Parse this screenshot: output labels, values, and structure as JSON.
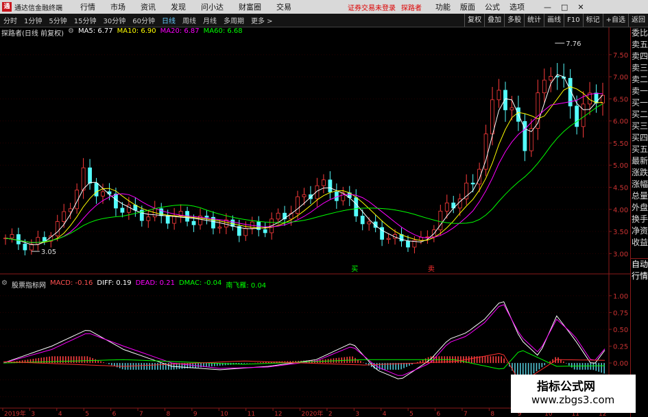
{
  "window": {
    "title": "通达信金融终端",
    "menus": [
      "行情",
      "市场",
      "资讯",
      "发现",
      "问小达",
      "财富圈",
      "交易"
    ],
    "warning": "证券交易未登录",
    "user": "探路者",
    "right_menus": [
      "功能",
      "版面",
      "公式",
      "选项"
    ],
    "ctrl_minimize": "—",
    "ctrl_maximize": "□",
    "ctrl_close": "✕",
    "ctrl_min_icon": "minimize-icon",
    "ctrl_max_icon": "maximize-icon",
    "ctrl_close_icon": "close-icon"
  },
  "toolbar": {
    "periods": [
      "分时",
      "1分钟",
      "5分钟",
      "15分钟",
      "30分钟",
      "60分钟",
      "日线",
      "周线",
      "月线",
      "多周期",
      "更多 >"
    ],
    "active": "日线",
    "tools": [
      "复权",
      "叠加",
      "多股",
      "统计",
      "画线",
      "F10",
      "标记",
      "+自选",
      "返回"
    ]
  },
  "main_legend": {
    "title": "探路者(日线 前复权)",
    "gear_icon": "settings-icon",
    "ma5": "MA5: 6.77",
    "ma10": "MA10: 6.90",
    "ma20": "MA20: 6.87",
    "ma60": "MA60: 6.68",
    "colors": {
      "ma5": "#ffffff",
      "ma10": "#ffff00",
      "ma20": "#ff00ff",
      "ma60": "#00ff00"
    }
  },
  "sub_legend": {
    "title": "股票指标网",
    "gear_icon": "settings-icon",
    "macd": "MACD: -0.16",
    "diff": "DIFF: 0.19",
    "dead": "DEAD: 0.21",
    "dmac": "DMAC: -0.04",
    "nfl": "南飞雁: 0.04",
    "colors": {
      "macd": "#ff5050",
      "diff": "#ffffff",
      "dead": "#ff00ff",
      "dmac": "#00ff00",
      "nfl": "#00ff00"
    }
  },
  "right_panel": {
    "upper": [
      "委比",
      "卖五",
      "卖四",
      "卖三",
      "卖二",
      "卖一",
      "买一",
      "买二",
      "买三",
      "买四",
      "买五",
      "最新",
      "涨跌",
      "涨幅",
      "总量",
      "外盘",
      "换手",
      "净资",
      "收益"
    ],
    "lower": [
      "自动",
      "行情"
    ]
  },
  "watermark": {
    "line1": "指标公式网",
    "line2": "www.zbgs3.com"
  },
  "chart_data": [
    {
      "type": "candlestick",
      "title": "探路者(日线 前复权)",
      "y_ticks": [
        3.0,
        3.5,
        4.0,
        4.5,
        5.0,
        5.5,
        6.0,
        6.5,
        7.0,
        7.5
      ],
      "ylim": [
        2.85,
        7.9
      ],
      "y_tick_labels": [
        "3.00",
        "3.50",
        "4.00",
        "4.50",
        "5.00",
        "5.50",
        "6.00",
        "6.50",
        "7.00",
        "7.50"
      ],
      "annotations": {
        "high_label": "7.76",
        "low_label": "3.05",
        "signal_buy": "买",
        "signal_sell": "卖"
      },
      "close_approx": {
        "x": [
          "2019-01",
          "2019-02",
          "2019-03",
          "2019-04",
          "2019-05",
          "2019-06",
          "2019-07",
          "2019-08",
          "2019-09",
          "2019-10",
          "2019-11",
          "2019-12",
          "2020-01",
          "2020-02",
          "2020-03",
          "2020-04",
          "2020-05",
          "2020-06",
          "2020-07",
          "2020-08",
          "2020-09",
          "2020-10",
          "2020-11",
          "2020-12"
        ],
        "close": [
          3.35,
          3.15,
          3.6,
          4.75,
          4.2,
          3.9,
          3.85,
          3.8,
          3.7,
          3.55,
          3.6,
          4.0,
          4.55,
          4.3,
          3.6,
          3.3,
          3.25,
          4.05,
          4.55,
          6.8,
          5.5,
          7.3,
          6.1,
          6.75
        ]
      },
      "series": [
        {
          "name": "MA5",
          "value": 6.77
        },
        {
          "name": "MA10",
          "value": 6.9
        },
        {
          "name": "MA20",
          "value": 6.87
        },
        {
          "name": "MA60",
          "value": 6.68
        }
      ]
    },
    {
      "type": "line",
      "title": "股票指标网",
      "y_ticks": [
        -0.5,
        -0.25,
        0.0,
        0.25,
        0.5,
        0.75,
        1.0
      ],
      "y_tick_labels": [
        "-0.50",
        "-0.25",
        "0.00",
        "0.25",
        "0.50",
        "0.75",
        "1.00"
      ],
      "ylim": [
        -0.65,
        1.08
      ],
      "x_tick_labels": [
        "2019年",
        "3",
        "4",
        "5",
        "6",
        "7",
        "8",
        "9",
        "10",
        "11",
        "12",
        "2020年",
        "2",
        "3",
        "4",
        "5",
        "6",
        "7",
        "8",
        "9",
        "10",
        "11",
        "12"
      ],
      "series": [
        {
          "name": "DIFF",
          "x": [
            0,
            8,
            14,
            20,
            28,
            36,
            44,
            52,
            58,
            62,
            66,
            71,
            74,
            77,
            80,
            83,
            86,
            89,
            92,
            95,
            98,
            100
          ],
          "values": [
            0.0,
            0.25,
            0.5,
            0.2,
            -0.05,
            -0.1,
            -0.05,
            0.05,
            0.3,
            -0.1,
            -0.25,
            0.05,
            0.35,
            0.45,
            0.65,
            0.95,
            0.35,
            0.1,
            0.7,
            0.35,
            -0.05,
            0.19
          ]
        },
        {
          "name": "DEAD",
          "x": [
            0,
            8,
            14,
            20,
            28,
            36,
            44,
            52,
            58,
            62,
            66,
            71,
            74,
            77,
            80,
            83,
            86,
            89,
            92,
            95,
            98,
            100
          ],
          "values": [
            0.0,
            0.2,
            0.45,
            0.25,
            0.0,
            -0.08,
            -0.06,
            0.03,
            0.25,
            -0.05,
            -0.2,
            0.0,
            0.3,
            0.4,
            0.6,
            0.9,
            0.4,
            0.15,
            0.65,
            0.4,
            0.0,
            0.21
          ]
        },
        {
          "name": "MACD",
          "x": [
            0,
            8,
            14,
            20,
            28,
            36,
            44,
            52,
            58,
            62,
            66,
            71,
            74,
            77,
            80,
            83,
            86,
            89,
            92,
            95,
            98,
            100
          ],
          "values": [
            0.0,
            0.1,
            0.1,
            -0.1,
            -0.1,
            -0.04,
            0.02,
            0.04,
            0.1,
            -0.1,
            -0.1,
            0.1,
            0.1,
            0.1,
            0.1,
            0.1,
            -0.3,
            -0.1,
            0.1,
            -0.1,
            -0.1,
            -0.16
          ]
        },
        {
          "name": "DMAC",
          "x": [
            0,
            20,
            40,
            60,
            75,
            83,
            86,
            92,
            100
          ],
          "values": [
            0.0,
            0.05,
            -0.02,
            0.05,
            0.05,
            -0.1,
            0.2,
            -0.05,
            -0.04
          ]
        },
        {
          "name": "南飞雁",
          "x": [
            0,
            20,
            40,
            60,
            75,
            83,
            86,
            92,
            100
          ],
          "values": [
            0.02,
            -0.05,
            0.03,
            -0.03,
            0.02,
            0.15,
            -0.3,
            0.05,
            0.04
          ]
        }
      ]
    }
  ]
}
